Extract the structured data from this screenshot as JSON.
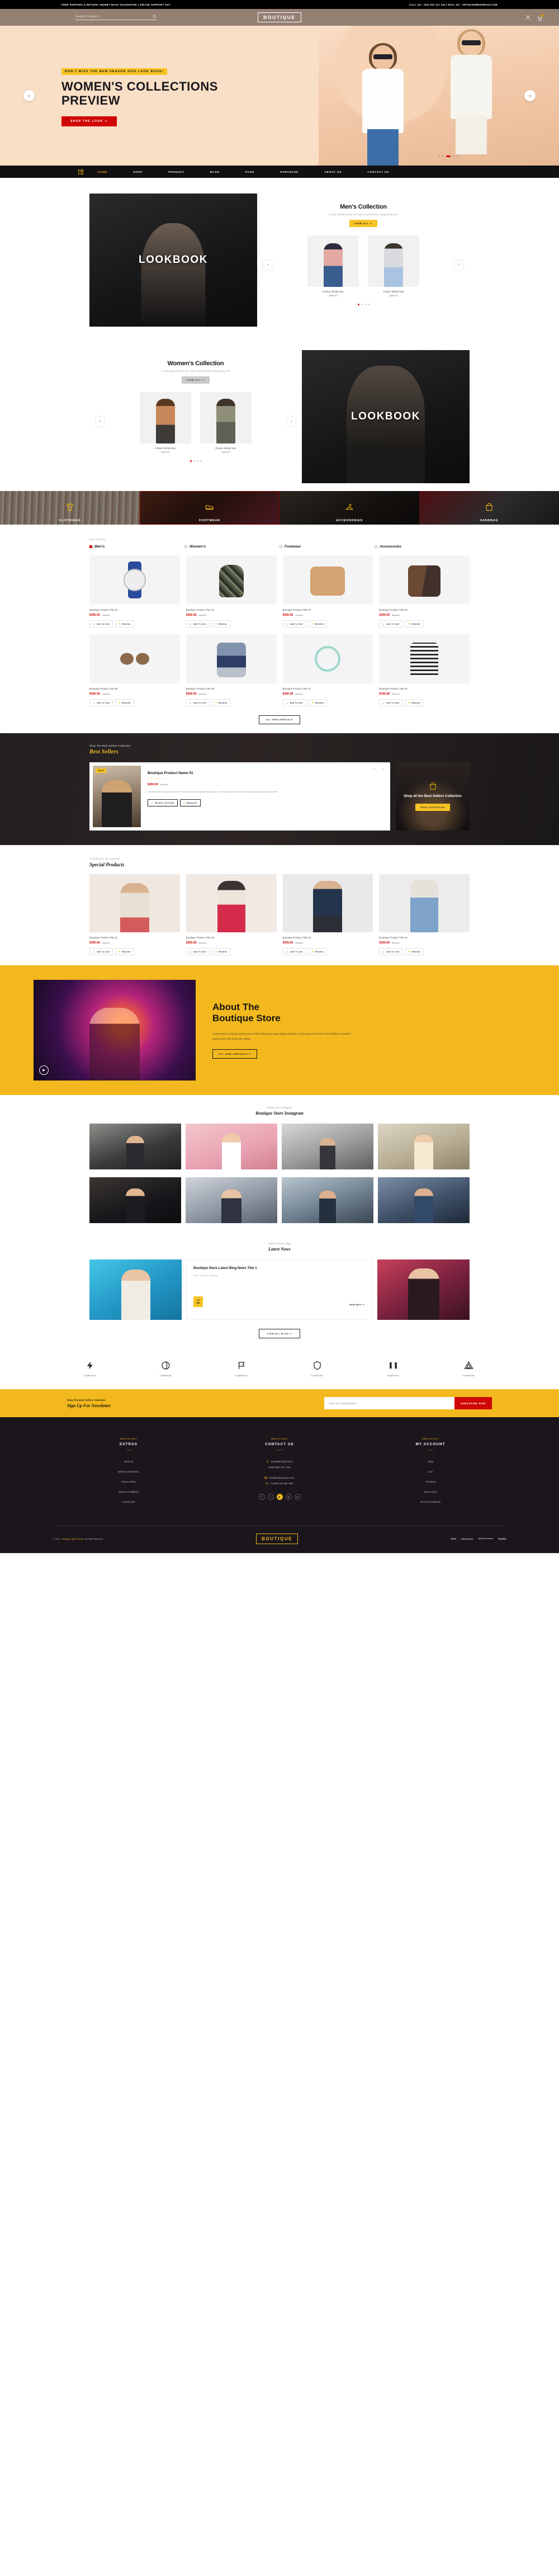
{
  "topbar": {
    "left": "FREE SHIPPING & RETURN  |  MONEY BACK GUARANTEE  |  ONLINE SUPPORT 24/7",
    "right": "CALL US : (00) 000 111 222  |  MAIL US : INFO@SOMEDOMAIN.COM"
  },
  "header": {
    "search_placeholder": "Search Product...",
    "search_value": "",
    "logo": "BOUTIQUE",
    "cart_count": "0"
  },
  "hero": {
    "tag": "DON'T MISS THE NEW SEASON 2020 LOOK BOOK!",
    "title_line1": "WOMEN'S COLLECTIONS",
    "title_line2": "PREVIEW",
    "button": "SHOP THE LOOK",
    "arrow_prev": "‹",
    "arrow_next": "›"
  },
  "nav": {
    "items": [
      {
        "label": "HOME",
        "active": true
      },
      {
        "label": "SHOP",
        "active": false
      },
      {
        "label": "PRODUCT",
        "active": false
      },
      {
        "label": "BLOG",
        "active": false
      },
      {
        "label": "PAGE",
        "active": false
      },
      {
        "label": "PURCHASE",
        "active": false
      },
      {
        "label": "ABOUT US",
        "active": false
      },
      {
        "label": "CONTACT US",
        "active": false
      }
    ]
  },
  "mens_collection": {
    "lookbook_text": "LOOKBOOK",
    "title": "Men's Collection",
    "subtitle": "Lorem ipsum dolor sit amet consectetur adipiscing elit",
    "button": "VIEW ALL",
    "products": [
      {
        "name": "Product full title here",
        "price": "$399.00"
      },
      {
        "name": "Product full title here",
        "price": "$399.00"
      }
    ]
  },
  "womens_collection": {
    "lookbook_text": "LOOKBOOK",
    "title": "Women's Collection",
    "subtitle": "Lorem ipsum dolor sit amet consectetur adipiscing elit",
    "button": "VIEW ALL",
    "products": [
      {
        "name": "Product full title here",
        "price": "$349.00"
      },
      {
        "name": "Product full title here",
        "price": "$349.00"
      }
    ]
  },
  "categories": [
    {
      "label": "CLOTHINGS",
      "icon": "tshirt-icon",
      "selected": false
    },
    {
      "label": "FOOTWEAR",
      "icon": "shoe-icon",
      "selected": true
    },
    {
      "label": "ACCESSORIES",
      "icon": "hanger-icon",
      "selected": false
    },
    {
      "label": "HANDBAG",
      "icon": "handbag-icon",
      "selected": false
    }
  ],
  "new_arrivals": {
    "label": "New Arrivals",
    "tabs": [
      {
        "label": "Men's",
        "active": true
      },
      {
        "label": "Women's",
        "active": false
      },
      {
        "label": "Footwear",
        "active": false
      },
      {
        "label": "Accessories",
        "active": false
      }
    ],
    "add_to_cart": "Add To Cart",
    "wishlist": "Wishlist",
    "view_all": "ALL NEW ARRIVALS",
    "products": [
      {
        "name": "Boutique Product Title 01",
        "price": "$390.99",
        "old_price": "$590.99"
      },
      {
        "name": "Boutique Product Title 02",
        "price": "$390.99",
        "old_price": "$590.99"
      },
      {
        "name": "Boutique Product Title 03",
        "price": "$390.99",
        "old_price": "$590.99"
      },
      {
        "name": "Boutique Product Title 04",
        "price": "$390.99",
        "old_price": "$590.99"
      },
      {
        "name": "Boutique Product Title 05",
        "price": "$390.99",
        "old_price": "$590.99"
      },
      {
        "name": "Boutique Product Title 06",
        "price": "$390.99",
        "old_price": "$590.99"
      },
      {
        "name": "Boutique Product Title 07",
        "price": "$390.99",
        "old_price": "$590.99"
      },
      {
        "name": "Boutique Product Title 08",
        "price": "$390.99",
        "old_price": "$590.99"
      }
    ]
  },
  "best_sellers": {
    "sub": "Shop The Best Sellers Collection",
    "title": "Best Sellers",
    "sale_badge": "SALE",
    "product_name": "Boutique Product Name 01",
    "stars": "☆☆☆☆☆",
    "price": "$390.99",
    "old_price": "$590.99",
    "description": "Lorem Ipsum is simply dummy text of the printing and typesetting industry. Lorem Ipsum has been the industry's standard dummy text ever.",
    "select_options": "SELECT OPTIONS",
    "wishlist": "WISHLIST",
    "side_title": "Shop all the Best Sellers Collection",
    "side_button": "Shop Collection",
    "arrow_prev": "←",
    "arrow_next": "→"
  },
  "special": {
    "label": "Trending in this season",
    "title": "Special Products",
    "add_to_cart": "Add To Cart",
    "wishlist": "Wishlist",
    "products": [
      {
        "name": "Boutique Product Title 01",
        "price": "$390.99",
        "old_price": "$590.99"
      },
      {
        "name": "Boutique Product Title 02",
        "price": "$390.99",
        "old_price": "$590.99"
      },
      {
        "name": "Boutique Product Title 03",
        "price": "$390.99",
        "old_price": "$590.99"
      },
      {
        "name": "Boutique Product Title 04",
        "price": "$390.99",
        "old_price": "$590.99"
      }
    ]
  },
  "about": {
    "title_line1": "About The",
    "title_line2": "Boutique Store",
    "paragraph": "Lorem Ipsum is simply dummy text of the printing and type setting industry. Lorem Ipsum has been the industry's standard dummy text ever since the 1500s.",
    "button": "ALL NEW ARRIVALS",
    "play_icon": "play-icon"
  },
  "instagram": {
    "sub": "Follow us on Instagram",
    "title": "Boutique Store Instagram"
  },
  "blog": {
    "sub": "Latest From the Blog",
    "title": "Latest News",
    "post_title": "Boutique Store Latest Blog News Title 1",
    "meta": "Admin    /    Fashion, Shopping",
    "date_day": "03",
    "date_month": "JUN",
    "read_more": "Read More",
    "view_all": "VIEW ALL BLOG"
  },
  "brands": [
    {
      "name": "COMPANY",
      "icon": "bolt-icon"
    },
    {
      "name": "COMPANY",
      "icon": "leaf-icon"
    },
    {
      "name": "COMPANY",
      "icon": "flag-icon"
    },
    {
      "name": "COMPANY",
      "icon": "shield-icon"
    },
    {
      "name": "COMPANY",
      "icon": "pillars-icon"
    },
    {
      "name": "COMPANY",
      "icon": "triangle-icon"
    }
  ],
  "newsletter": {
    "sub": "Shop The Best Sellers Collection",
    "title": "Sign Up For Newsletter",
    "placeholder": "Enter your email address",
    "value": "",
    "button": "SUBSCRIBE NOW"
  },
  "footer": {
    "columns": [
      {
        "script": "Talk to Us Now !",
        "title": "EXTRAS",
        "links": [
          "About Us",
          "Delivery Information",
          "Privacy Policy",
          "Terms & Conditions",
          "Contact Ush"
        ]
      },
      {
        "script": "Talk to Us Now !",
        "title": "CONTACT US",
        "address_line1": "11100956 Wall Street",
        "address_line2": "Washington DC, USA",
        "email": "info@boutiquestore.com",
        "phone": "(+1800) 123 456 7890",
        "socials": [
          "f",
          "t",
          "yt",
          "ig",
          "w"
        ]
      },
      {
        "script": "Talk to Us Now !",
        "title": "MY ACCOUNT",
        "links": [
          "Shop",
          "Cart",
          "Checkout",
          "My Account",
          "Terms & Conditions"
        ]
      }
    ],
    "copyright_prefix": "© 2020 - ",
    "copyright_brand": "Boutique Store Theme.",
    "copyright_suffix": " All Right Reserved.",
    "logo": "BOUTIQUE",
    "payments": [
      "VISA",
      "MasterCard",
      "AMERICAN EXPRESS",
      "PayPal"
    ]
  }
}
